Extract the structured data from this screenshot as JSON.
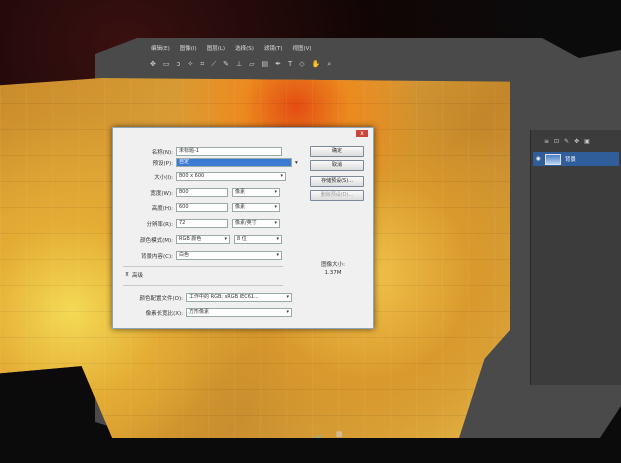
{
  "menu": [
    "编辑(E)",
    "图像(I)",
    "图层(L)",
    "选择(S)",
    "滤镜(T)",
    "视图(V)"
  ],
  "toolbar_icons": [
    "move-icon",
    "marquee-icon",
    "lasso-icon",
    "wand-icon",
    "crop-icon",
    "eyedropper-icon",
    "brush-icon",
    "stamp-icon",
    "eraser-icon",
    "gradient-icon",
    "pen-icon",
    "text-icon",
    "shape-icon",
    "hand-icon",
    "zoom-icon"
  ],
  "dialog": {
    "close": "x",
    "name_label": "名称(N):",
    "name_value": "未标题-1",
    "preset_label": "预设(P):",
    "preset_value": "自定",
    "size_label": "大小(I):",
    "size_value": "800 x 600",
    "width_label": "宽度(W):",
    "width_value": "800",
    "width_unit": "像素",
    "height_label": "高度(H):",
    "height_value": "600",
    "height_unit": "像素",
    "res_label": "分辨率(R):",
    "res_value": "72",
    "res_unit": "像素/英寸",
    "mode_label": "颜色模式(M):",
    "mode_value": "RGB 颜色",
    "mode_bits": "8 位",
    "bg_label": "背景内容(C):",
    "bg_value": "白色",
    "advanced": "高级",
    "profile_label": "颜色配置文件(O):",
    "profile_value": "工作中的 RGB: sRGB IEC61...",
    "aspect_label": "像素长宽比(X):",
    "aspect_value": "方形像素",
    "ok": "确定",
    "cancel": "取消",
    "save_preset": "存储预设(S)...",
    "delete_preset": "删除预设(D)...",
    "image_size_label": "图像大小:",
    "image_size_value": "1.37M"
  },
  "layers": {
    "name": "背景"
  }
}
